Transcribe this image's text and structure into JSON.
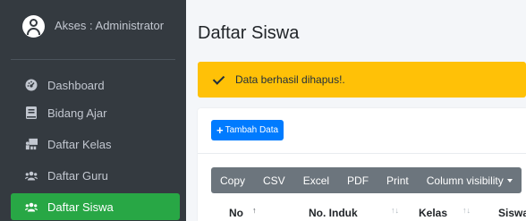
{
  "sidebar": {
    "user_label": "Akses : Administrator",
    "items": [
      {
        "label": "Dashboard",
        "icon": "dashboard-icon"
      },
      {
        "label": "Bidang Ajar",
        "icon": "book-icon"
      },
      {
        "label": "Daftar Kelas",
        "icon": "classroom-icon"
      },
      {
        "label": "Daftar Guru",
        "icon": "users-icon"
      },
      {
        "label": "Daftar Siswa",
        "icon": "users-icon",
        "active": true
      }
    ]
  },
  "main": {
    "page_title": "Daftar Siswa",
    "alert": {
      "message": "Data berhasil dihapus!.",
      "color": "#ffc107"
    },
    "add_button": {
      "label": "Tambah Data"
    },
    "export_buttons": [
      "Copy",
      "CSV",
      "Excel",
      "PDF",
      "Print",
      "Column visibility"
    ],
    "table": {
      "headers": [
        "No",
        "No. Induk",
        "Kelas",
        "Siswa"
      ]
    }
  },
  "colors": {
    "sidebar_bg": "#343a40",
    "active_item": "#28a745",
    "primary": "#007bff",
    "secondary": "#6c757d",
    "warning": "#ffc107"
  }
}
